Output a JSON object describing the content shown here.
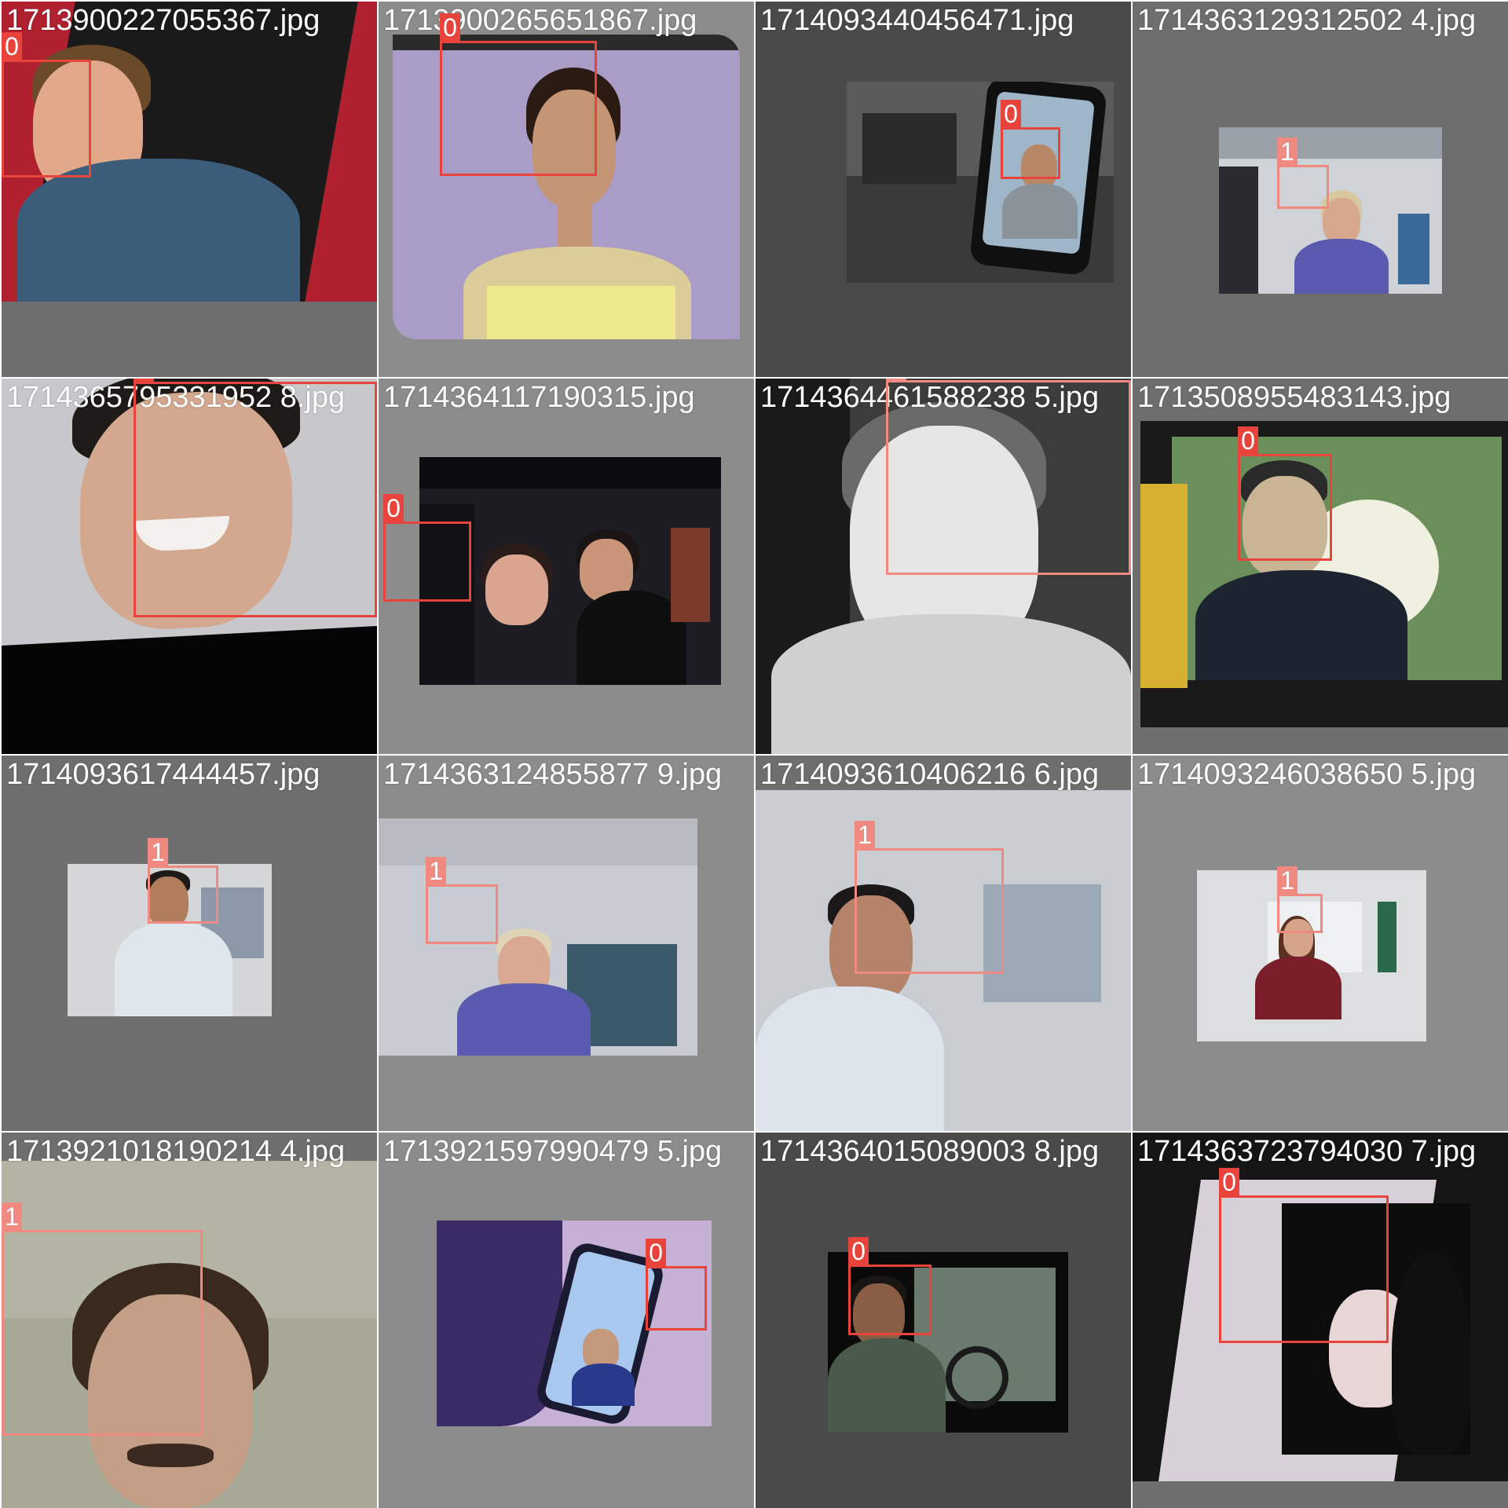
{
  "tiles": [
    {
      "filename": "1713900227055367.jpg",
      "boxes": [
        {
          "cls": "0"
        }
      ]
    },
    {
      "filename": "1713900265651867.jpg",
      "boxes": [
        {
          "cls": "0"
        }
      ]
    },
    {
      "filename": "1714093440456471.jpg",
      "boxes": [
        {
          "cls": "0"
        }
      ]
    },
    {
      "filename": "1714363129312502 4.jpg",
      "boxes": [
        {
          "cls": "1"
        }
      ]
    },
    {
      "filename": "1714365795331952 8.jpg",
      "boxes": [
        {
          "cls": "0"
        }
      ]
    },
    {
      "filename": "1714364117190315.jpg",
      "boxes": [
        {
          "cls": "0"
        }
      ]
    },
    {
      "filename": "1714364461588238 5.jpg",
      "boxes": [
        {
          "cls": "1"
        }
      ]
    },
    {
      "filename": "1713508955483143.jpg",
      "boxes": [
        {
          "cls": "0"
        }
      ]
    },
    {
      "filename": "1714093617444457.jpg",
      "boxes": [
        {
          "cls": "1"
        }
      ]
    },
    {
      "filename": "1714363124855877 9.jpg",
      "boxes": [
        {
          "cls": "1"
        }
      ]
    },
    {
      "filename": "1714093610406216 6.jpg",
      "boxes": [
        {
          "cls": "1"
        }
      ]
    },
    {
      "filename": "1714093246038650 5.jpg",
      "boxes": [
        {
          "cls": "1"
        }
      ]
    },
    {
      "filename": "1713921018190214 4.jpg",
      "boxes": [
        {
          "cls": "1"
        }
      ]
    },
    {
      "filename": "1713921597990479 5.jpg",
      "boxes": [
        {
          "cls": "0"
        }
      ]
    },
    {
      "filename": "1714364015089003 8.jpg",
      "boxes": [
        {
          "cls": "0"
        }
      ]
    },
    {
      "filename": "1714363723794030 7.jpg",
      "boxes": [
        {
          "cls": "0"
        }
      ]
    }
  ],
  "colors": {
    "class0": "#e8443c",
    "class1": "#f08a80"
  }
}
